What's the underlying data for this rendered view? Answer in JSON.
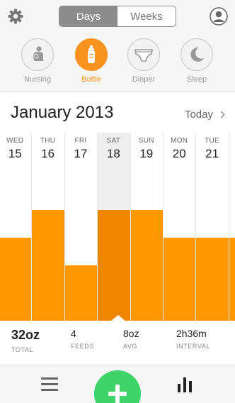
{
  "header": {
    "tabs": [
      {
        "label": "Days",
        "active": true
      },
      {
        "label": "Weeks",
        "active": false
      }
    ],
    "categories": [
      {
        "label": "Nursing",
        "icon": "nursing-icon",
        "active": false
      },
      {
        "label": "Bottle",
        "icon": "bottle-icon",
        "active": true
      },
      {
        "label": "Diaper",
        "icon": "diaper-icon",
        "active": false
      },
      {
        "label": "Sleep",
        "icon": "moon-icon",
        "active": false
      }
    ]
  },
  "calendar": {
    "month_title": "January 2013",
    "today_label": "Today"
  },
  "chart_data": {
    "type": "bar",
    "categories": [
      "WED",
      "THU",
      "FRI",
      "SAT",
      "SUN",
      "MON",
      "TUE"
    ],
    "day_numbers": [
      "15",
      "16",
      "17",
      "18",
      "19",
      "20",
      "21"
    ],
    "values": [
      3,
      4,
      2,
      4,
      4,
      3,
      3
    ],
    "selected_index": 3,
    "ylim": [
      0,
      6.8
    ],
    "grid": false,
    "title": "",
    "xlabel": "",
    "ylabel": ""
  },
  "stats": {
    "total": {
      "value": "32oz",
      "label": "TOTAL"
    },
    "feeds": {
      "value": "4",
      "label": "FEEDS"
    },
    "avg": {
      "value": "8oz",
      "label": "AVG"
    },
    "interval": {
      "value": "2h36m",
      "label": "INTERVAL"
    }
  },
  "colors": {
    "accent": "#f7931e",
    "bar": "#ff9702",
    "bar_selected": "#ee8600",
    "add_button": "#3fd36a"
  }
}
